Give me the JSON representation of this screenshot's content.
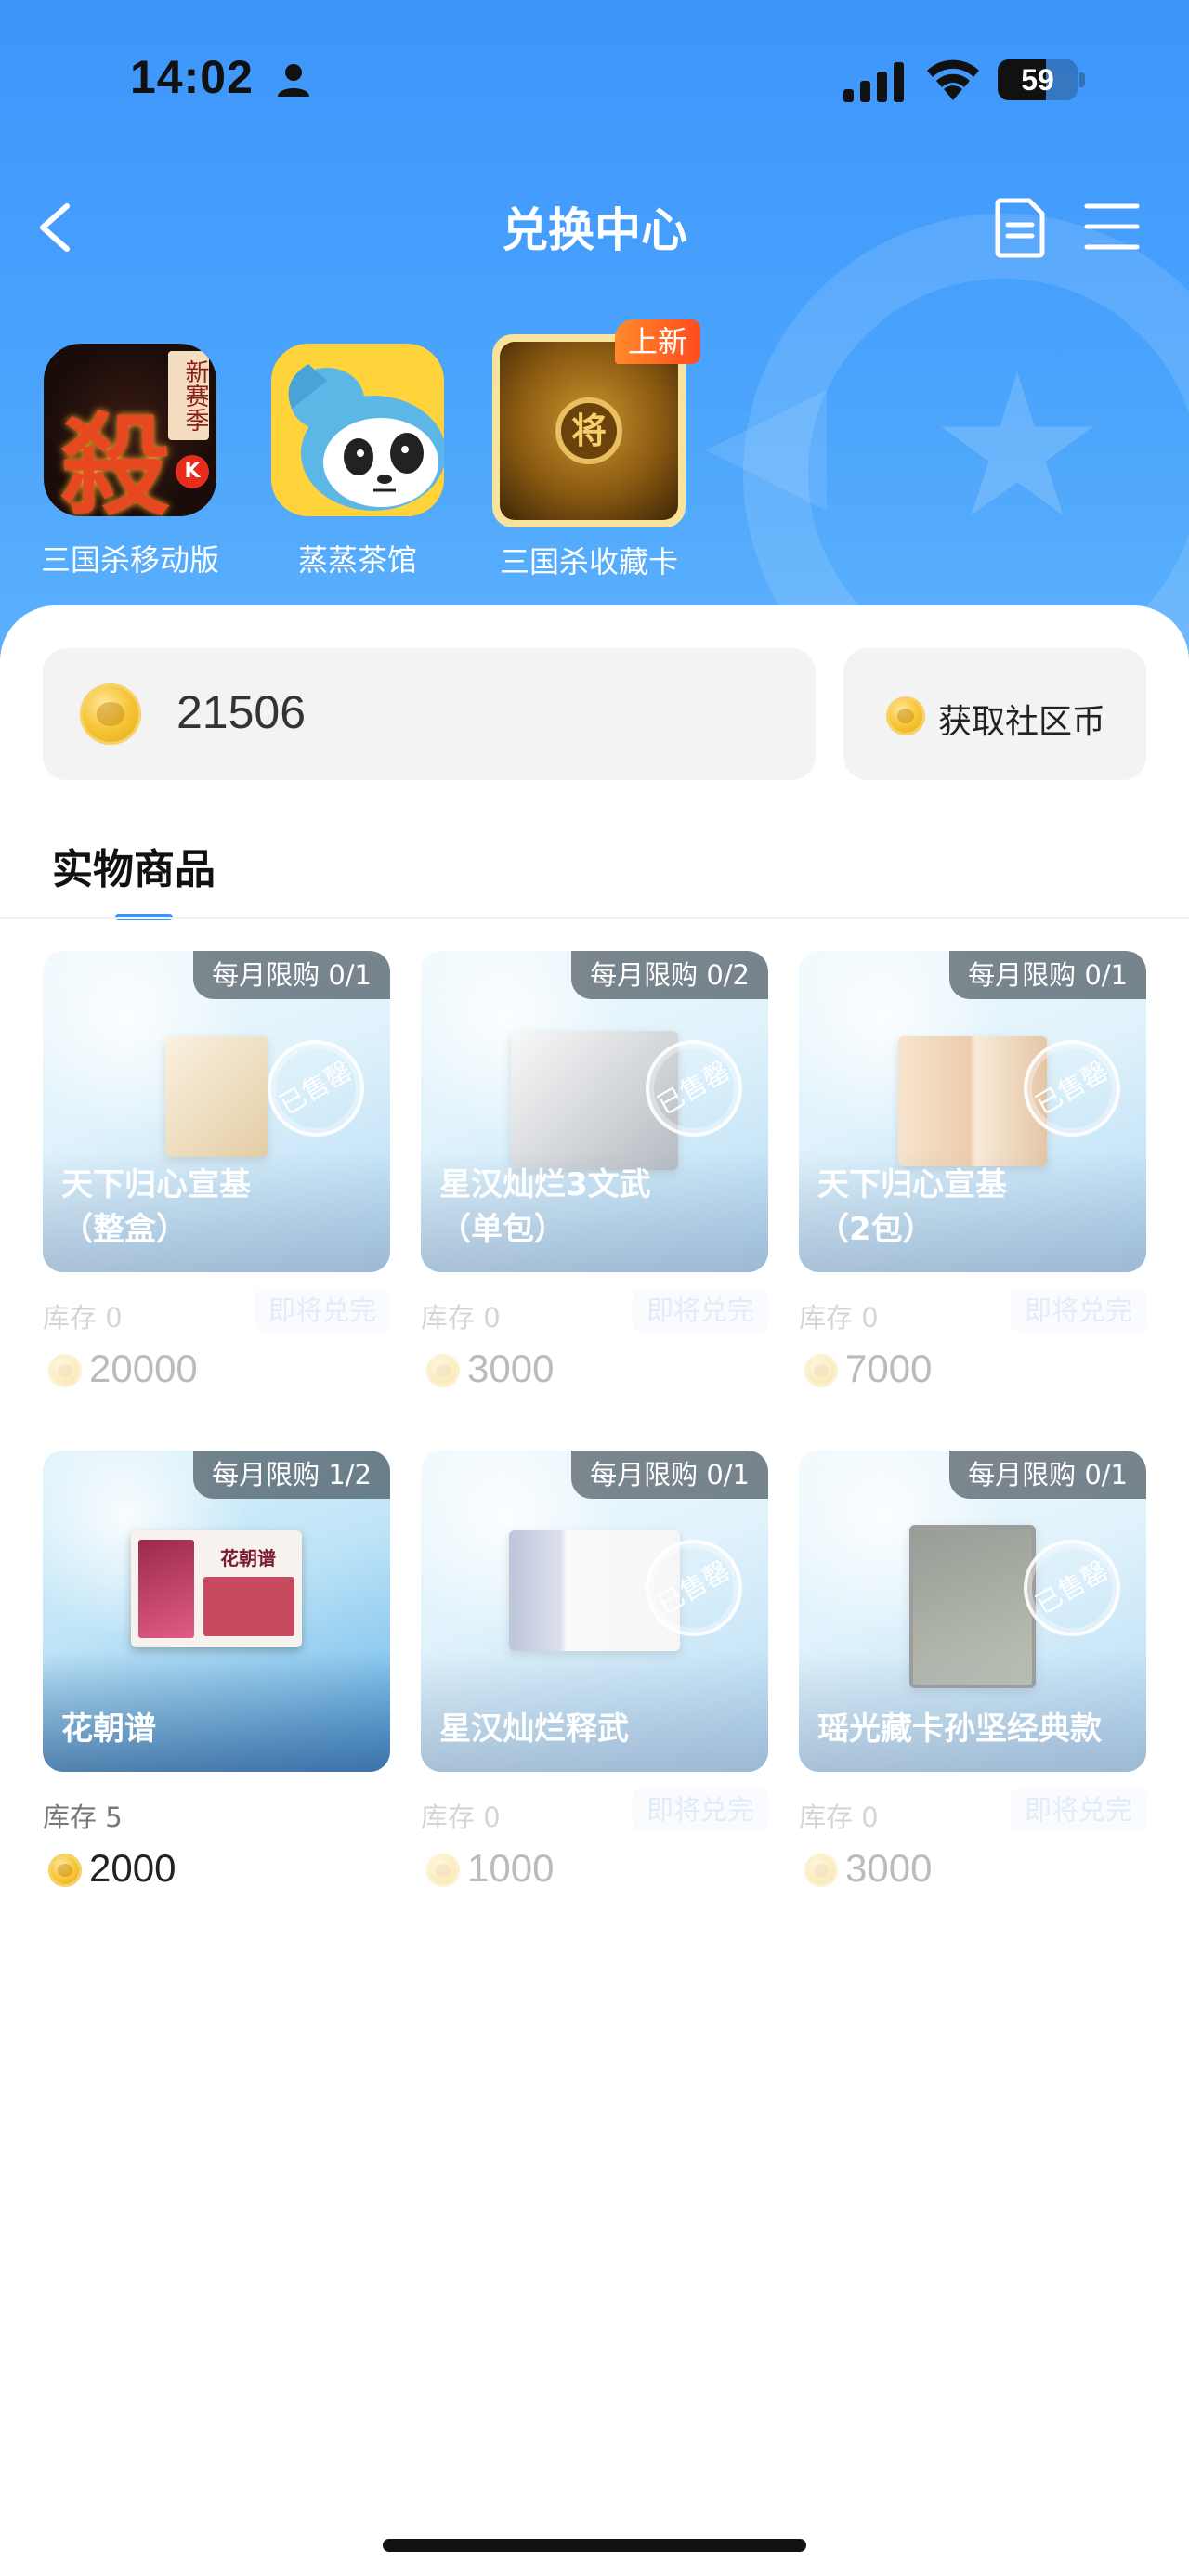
{
  "status_bar": {
    "time": "14:02",
    "battery": "59"
  },
  "header": {
    "title": "兑换中心"
  },
  "games": [
    {
      "label": "三国杀移动版",
      "icon_char": "殺",
      "icon_tag": "新赛季",
      "icon_corner": "K"
    },
    {
      "label": "蒸蒸茶馆"
    },
    {
      "label": "三国杀收藏卡",
      "icon_char": "将",
      "badge": "上新"
    }
  ],
  "balance": {
    "value": "21506"
  },
  "earn_button": {
    "label": "获取社区币"
  },
  "section": {
    "tab": "实物商品"
  },
  "products": [
    {
      "name": "天下归心宣基\n（整盒）",
      "limit": "每月限购 0/1",
      "stock": "库存 0",
      "status": "即将兑完",
      "price": "20000",
      "sold_out": "已售罄"
    },
    {
      "name": "星汉灿烂3文武\n（单包）",
      "limit": "每月限购 0/2",
      "stock": "库存 0",
      "status": "即将兑完",
      "price": "3000",
      "sold_out": "已售罄"
    },
    {
      "name": "天下归心宣基\n（2包）",
      "limit": "每月限购 0/1",
      "stock": "库存 0",
      "status": "即将兑完",
      "price": "7000",
      "sold_out": "已售罄"
    },
    {
      "name": "花朝谱",
      "limit": "每月限购 1/2",
      "stock": "库存 5",
      "price": "2000",
      "box_text": "花朝谱"
    },
    {
      "name": "星汉灿烂释武",
      "limit": "每月限购 0/1",
      "stock": "库存 0",
      "status": "即将兑完",
      "price": "1000",
      "sold_out": "已售罄"
    },
    {
      "name": "瑶光藏卡孙坚经典款",
      "limit": "每月限购 0/1",
      "stock": "库存 0",
      "status": "即将兑完",
      "price": "3000",
      "sold_out": "已售罄"
    }
  ],
  "colors": {
    "accent": "#3d95fb",
    "header_top": "#3d95fb",
    "badge_orange": "#ff6a24"
  }
}
